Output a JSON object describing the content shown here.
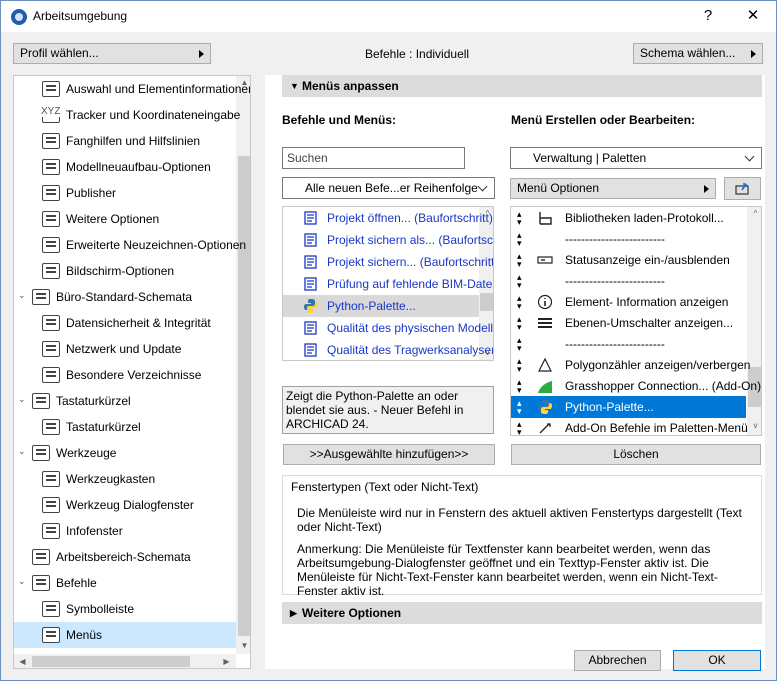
{
  "window": {
    "title": "Arbeitsumgebung",
    "help_label": "?",
    "close_label": "✕"
  },
  "top": {
    "profile_btn": "Profil wählen...",
    "commands_label": "Befehle : Individuell",
    "scheme_btn": "Schema wählen..."
  },
  "tree": {
    "items": [
      {
        "label": "Auswahl und Elementinformationen",
        "indent": 2,
        "glyph": ""
      },
      {
        "label": "Tracker und Koordinateneingabe",
        "indent": 2,
        "glyph": "XYZ"
      },
      {
        "label": "Fanghilfen und Hilfslinien",
        "indent": 2,
        "glyph": ""
      },
      {
        "label": "Modellneuaufbau-Optionen",
        "indent": 2,
        "glyph": ""
      },
      {
        "label": "Publisher",
        "indent": 2,
        "glyph": ""
      },
      {
        "label": "Weitere Optionen",
        "indent": 2,
        "glyph": ""
      },
      {
        "label": "Erweiterte Neuzeichnen-Optionen",
        "indent": 2,
        "glyph": ""
      },
      {
        "label": "Bildschirm-Optionen",
        "indent": 2,
        "glyph": ""
      },
      {
        "label": "Büro-Standard-Schemata",
        "indent": 1,
        "glyph": "",
        "expanded": true
      },
      {
        "label": "Datensicherheit & Integrität",
        "indent": 2,
        "glyph": ""
      },
      {
        "label": "Netzwerk und Update",
        "indent": 2,
        "glyph": ""
      },
      {
        "label": "Besondere Verzeichnisse",
        "indent": 2,
        "glyph": ""
      },
      {
        "label": "Tastaturkürzel",
        "indent": 1,
        "glyph": "",
        "expanded": true
      },
      {
        "label": "Tastaturkürzel",
        "indent": 2,
        "glyph": ""
      },
      {
        "label": "Werkzeuge",
        "indent": 1,
        "glyph": "",
        "expanded": true
      },
      {
        "label": "Werkzeugkasten",
        "indent": 2,
        "glyph": ""
      },
      {
        "label": "Werkzeug Dialogfenster",
        "indent": 2,
        "glyph": ""
      },
      {
        "label": "Infofenster",
        "indent": 2,
        "glyph": ""
      },
      {
        "label": "Arbeitsbereich-Schemata",
        "indent": 1,
        "glyph": ""
      },
      {
        "label": "Befehle",
        "indent": 1,
        "glyph": "",
        "expanded": true
      },
      {
        "label": "Symbolleiste",
        "indent": 2,
        "glyph": ""
      },
      {
        "label": "Menüs",
        "indent": 2,
        "glyph": "",
        "selected": true
      }
    ]
  },
  "section_menus": {
    "title": "Menüs anpassen"
  },
  "left_col": {
    "title": "Befehle und Menüs:",
    "search_placeholder": "Suchen",
    "filter_value": "Alle neuen Befe...er Reihenfolge",
    "commands": [
      {
        "label": "Projekt öffnen... (Baufortschritt)",
        "blue": true
      },
      {
        "label": "Projekt sichern als... (Baufortschritt)",
        "blue": true
      },
      {
        "label": "Projekt sichern... (Baufortschritt)",
        "blue": true
      },
      {
        "label": "Prüfung auf fehlende BIM-Daten",
        "blue": true
      },
      {
        "label": "Python-Palette...",
        "blue": true,
        "highlight": true,
        "python": true
      },
      {
        "label": "Qualität des physischen Modells",
        "blue": true
      },
      {
        "label": "Qualität des Tragwerksanalysemodells",
        "blue": true
      }
    ],
    "description": "Zeigt die Python-Palette an oder blendet sie aus. - Neuer Befehl in ARCHICAD 24.",
    "add_btn": ">>Ausgewählte hinzufügen>>"
  },
  "right_col": {
    "title": "Menü Erstellen oder Bearbeiten:",
    "menu_value": "Verwaltung | Paletten",
    "options_btn": "Menü Optionen",
    "items": [
      {
        "label": "Bibliotheken laden-Protokoll...",
        "icon": "books"
      },
      {
        "label": "-------------------------",
        "icon": ""
      },
      {
        "label": "Statusanzeige ein-/ausblenden",
        "icon": "status"
      },
      {
        "label": "-------------------------",
        "icon": ""
      },
      {
        "label": "Element- Information anzeigen",
        "icon": "info"
      },
      {
        "label": "Ebenen-Umschalter anzeigen...",
        "icon": "layers"
      },
      {
        "label": "-------------------------",
        "icon": ""
      },
      {
        "label": "Polygonzähler anzeigen/verbergen",
        "icon": "poly"
      },
      {
        "label": "Grasshopper Connection... (Add-On)",
        "icon": "grass"
      },
      {
        "label": "Python-Palette...",
        "icon": "python",
        "selected": true
      },
      {
        "label": "Add-On Befehle im Paletten-Menü",
        "icon": "addon"
      }
    ],
    "delete_btn": "Löschen"
  },
  "window_types": {
    "title": "Fenstertypen (Text oder Nicht-Text)",
    "p1": "Die Menüleiste wird nur in Fenstern des aktuell aktiven Fenstertyps dargestellt (Text oder Nicht-Text)",
    "p2": "Anmerkung: Die Menüleiste für Textfenster kann bearbeitet werden, wenn das Arbeitsumgebung-Dialogfenster geöffnet und ein Texttyp-Fenster aktiv ist. Die Menüleiste für Nicht-Text-Fenster kann bearbeitet werden, wenn ein Nicht-Text-Fenster aktiv ist."
  },
  "section_more": {
    "title": "Weitere Optionen"
  },
  "footer": {
    "cancel_btn": "Abbrechen",
    "ok_btn": "OK"
  },
  "colors": {
    "accent": "#0078d7",
    "link": "#1a36c8",
    "selection": "#cce8ff"
  }
}
